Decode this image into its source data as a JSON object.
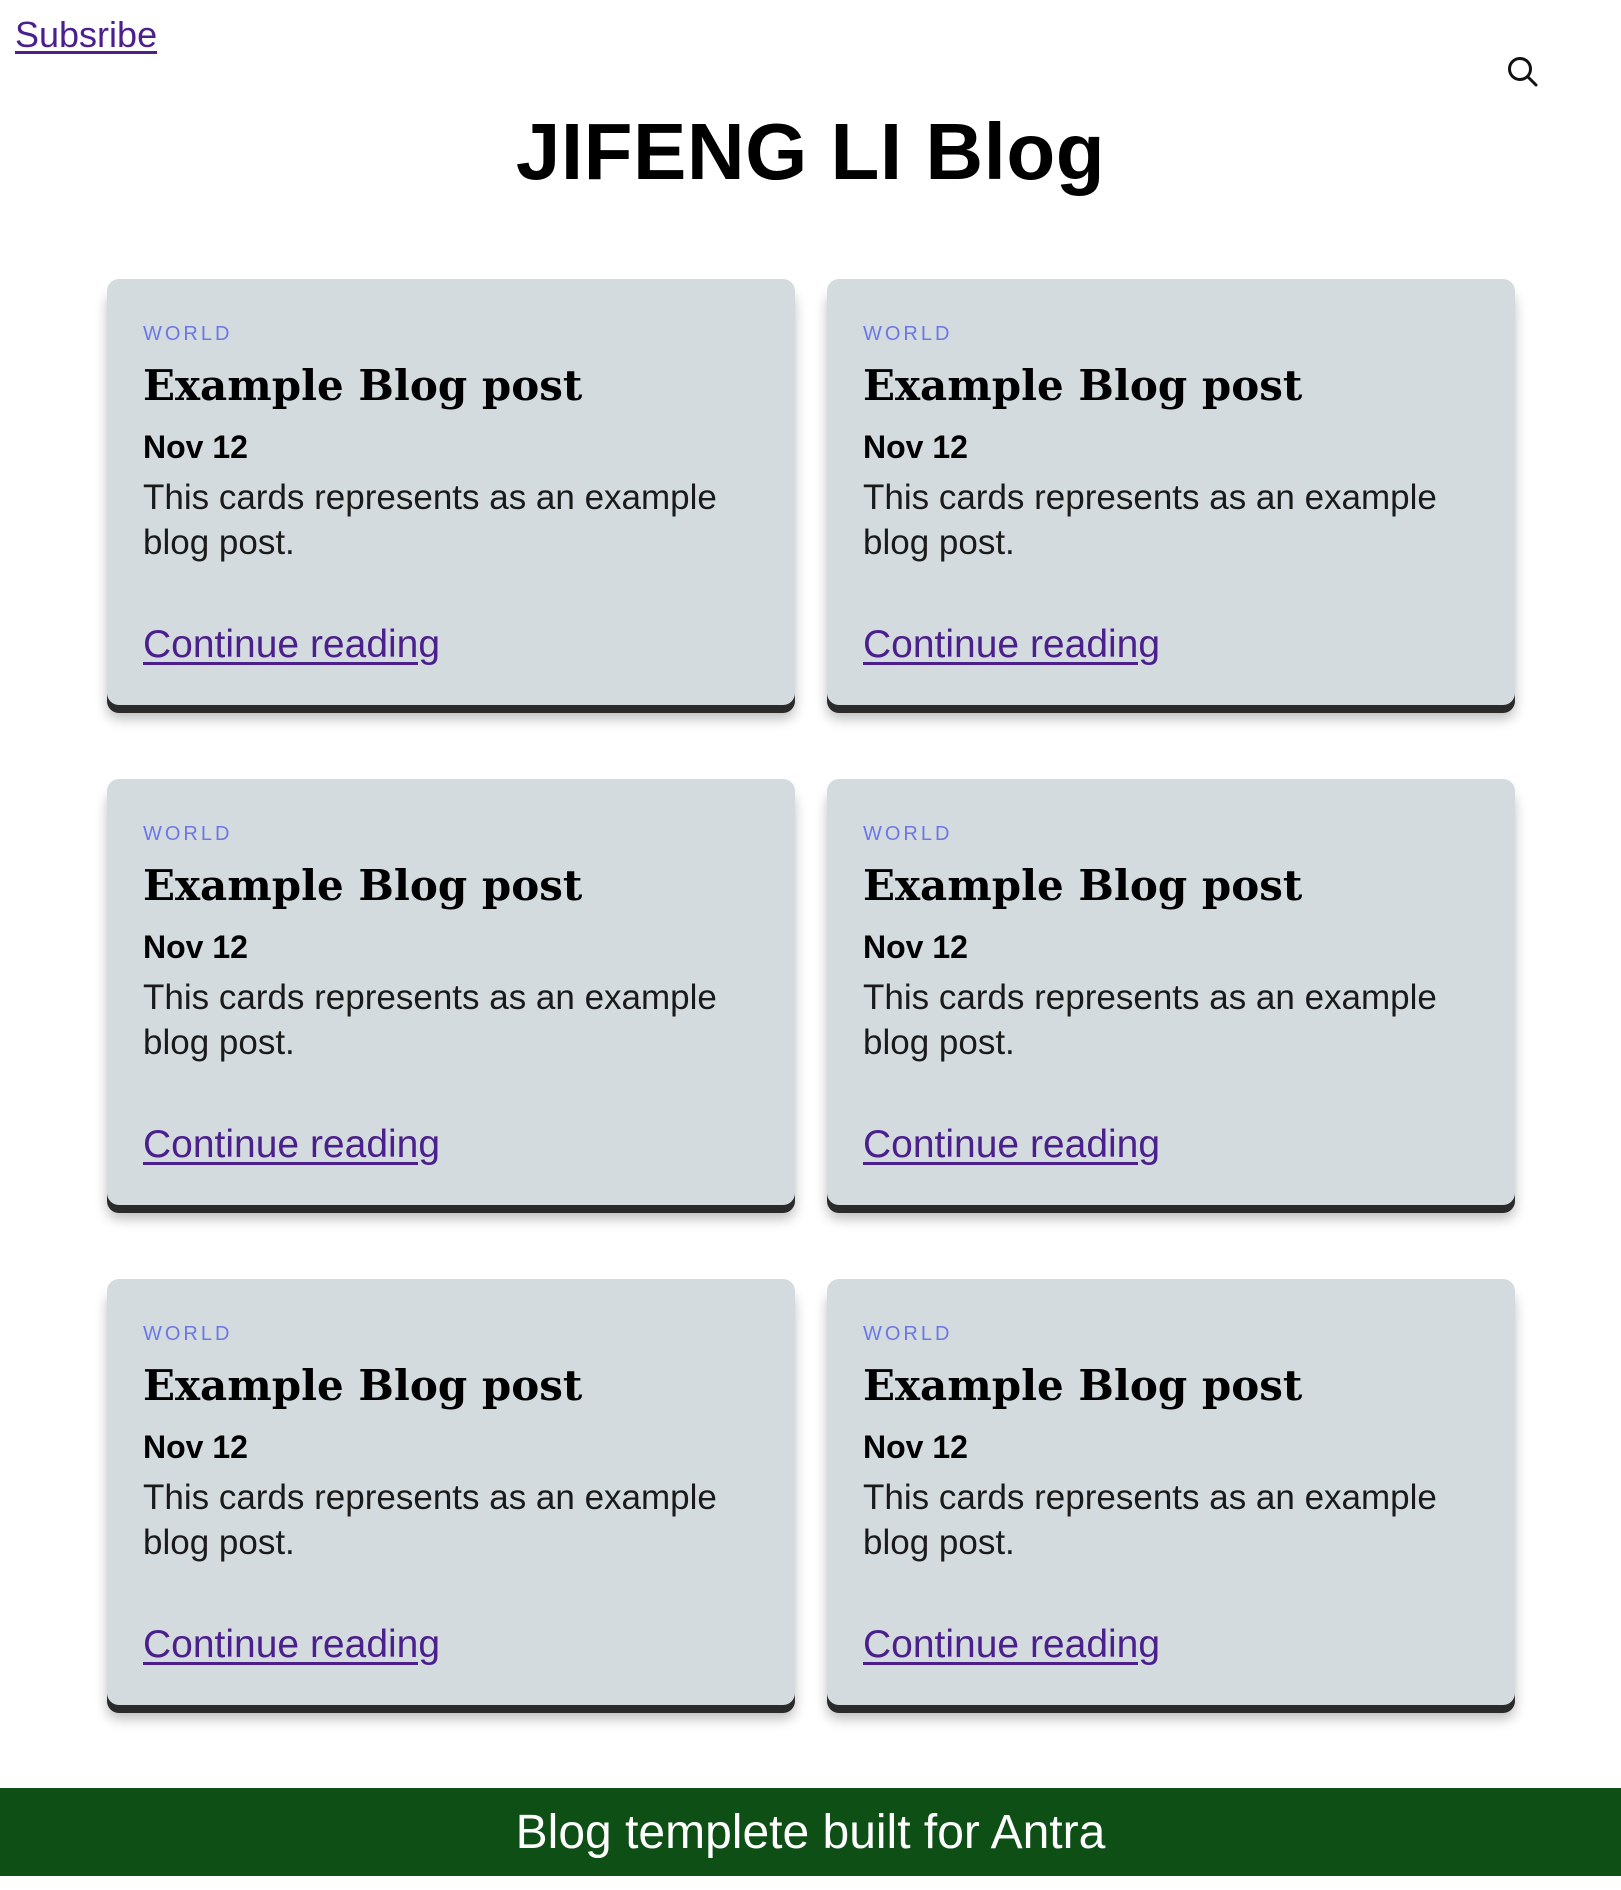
{
  "header": {
    "subscribe_label": "Subsribe",
    "search_icon": "search-icon",
    "title": "JIFENG LI Blog"
  },
  "posts": [
    {
      "category": "WORLD",
      "title": "Example Blog post",
      "date": "Nov 12",
      "excerpt": "This cards represents as an example blog post.",
      "link_label": "Continue reading"
    },
    {
      "category": "WORLD",
      "title": "Example Blog post",
      "date": "Nov 12",
      "excerpt": "This cards represents as an example blog post.",
      "link_label": "Continue reading"
    },
    {
      "category": "WORLD",
      "title": "Example Blog post",
      "date": "Nov 12",
      "excerpt": "This cards represents as an example blog post.",
      "link_label": "Continue reading"
    },
    {
      "category": "WORLD",
      "title": "Example Blog post",
      "date": "Nov 12",
      "excerpt": "This cards represents as an example blog post.",
      "link_label": "Continue reading"
    },
    {
      "category": "WORLD",
      "title": "Example Blog post",
      "date": "Nov 12",
      "excerpt": "This cards represents as an example blog post.",
      "link_label": "Continue reading"
    },
    {
      "category": "WORLD",
      "title": "Example Blog post",
      "date": "Nov 12",
      "excerpt": "This cards represents as an example blog post.",
      "link_label": "Continue reading"
    }
  ],
  "footer": {
    "text": "Blog templete built for Antra",
    "background_color": "#0e4f16"
  },
  "colors": {
    "card_background": "#d3dbde",
    "category_accent": "#6b78e6",
    "link": "#4b1f8c"
  }
}
